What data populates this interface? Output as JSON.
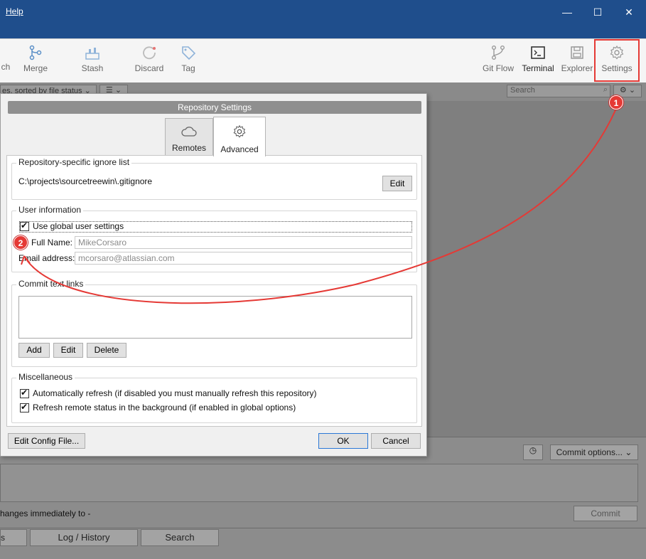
{
  "titlebar": {
    "menu_help": "Help",
    "controls": {
      "minimize": "—",
      "maximize": "☐",
      "close": "✕"
    }
  },
  "toolbar": {
    "left_cut_label": "ch",
    "merge": "Merge",
    "stash": "Stash",
    "discard": "Discard",
    "tag": "Tag",
    "git_flow": "Git Flow",
    "terminal": "Terminal",
    "explorer": "Explorer",
    "settings": "Settings"
  },
  "filterbar": {
    "sort_label": "es, sorted by file status",
    "search_placeholder": "Search"
  },
  "dialog": {
    "title": "Repository Settings",
    "tabs": {
      "remotes": "Remotes",
      "advanced": "Advanced"
    },
    "ignore_group": {
      "label": "Repository-specific ignore list",
      "path": "C:\\projects\\sourcetreewin\\.gitignore",
      "edit": "Edit"
    },
    "user_group": {
      "label": "User information",
      "use_global": "Use global user settings",
      "full_name_label": "Full Name:",
      "full_name_value": "MikeCorsaro",
      "email_label": "Email address:",
      "email_value": "mcorsaro@atlassian.com"
    },
    "commit_links_group": {
      "label": "Commit text links",
      "add": "Add",
      "edit": "Edit",
      "delete": "Delete"
    },
    "misc_group": {
      "label": "Miscellaneous",
      "auto_refresh": "Automatically refresh (if disabled you must manually refresh this repository)",
      "remote_status": "Refresh remote status in the background (if enabled in global options)"
    },
    "edit_config": "Edit Config File...",
    "ok": "OK",
    "cancel": "Cancel"
  },
  "bottom": {
    "commit_options": "Commit options...",
    "push_text": "hanges immediately to -",
    "commit": "Commit",
    "tab_left_cut": "s",
    "tab_log": "Log / History",
    "tab_search": "Search"
  },
  "annotations": {
    "badge1": "1",
    "badge2": "2"
  },
  "colors": {
    "titlebar": "#1f4e8c",
    "highlight": "#e53935"
  }
}
